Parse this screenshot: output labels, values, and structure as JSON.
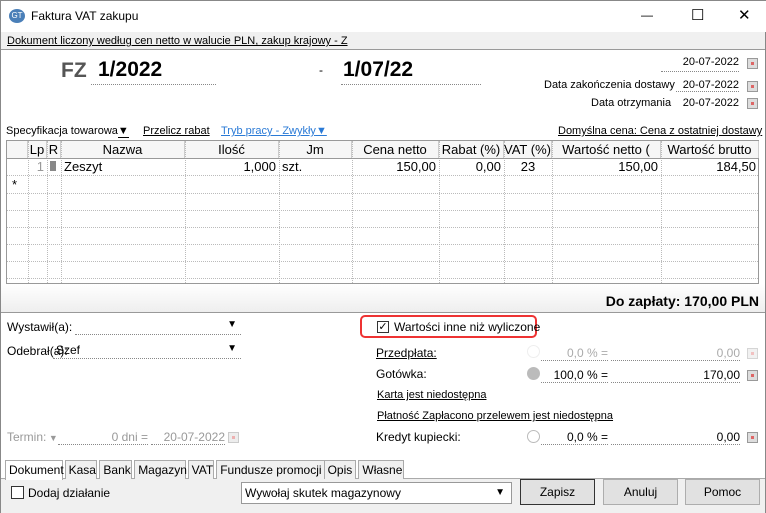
{
  "window": {
    "title": "Faktura VAT zakupu",
    "minimize": "—",
    "maximize": "☐",
    "close": "✕"
  },
  "doc_info": "Dokument liczony według cen netto w walucie PLN, zakup krajowy - Z",
  "header": {
    "prefix": "FZ",
    "number": "1/2022",
    "separator": "-",
    "suffix": "1/07/22",
    "date_issue": "20-07-2022",
    "date_delivery_label": "Data zakończenia dostawy",
    "date_delivery": "20-07-2022",
    "date_received_label": "Data otrzymania",
    "date_received": "20-07-2022"
  },
  "toolbar": {
    "spec": "Specyfikacja towarowa",
    "recalc": "Przelicz rabat",
    "mode": "Tryb pracy - Zwykły",
    "default_price": "Domyślna cena: Cena z ostatniej dostawy"
  },
  "table": {
    "columns": [
      "Lp",
      "R",
      "Nazwa",
      "Ilość",
      "Jm",
      "Cena netto",
      "Rabat (%)",
      "VAT (%)",
      "Wartość netto (",
      "Wartość brutto"
    ],
    "rows": [
      {
        "lp": "1",
        "name": "Zeszyt",
        "qty": "1,000",
        "unit": "szt.",
        "price": "150,00",
        "discount": "0,00",
        "vat": "23",
        "net": "150,00",
        "gross": "184,50"
      }
    ],
    "new_row_marker": "*"
  },
  "total": "Do zapłaty: 170,00 PLN",
  "left": {
    "issued_label": "Wystawił(a):",
    "issued_value": "",
    "received_label": "Odebrał(a):",
    "received_value": "Szef",
    "term_label": "Termin:",
    "term_days": "0 dni =",
    "term_date": "20-07-2022"
  },
  "payment": {
    "override_label": "Wartości inne niż wyliczone",
    "override_checked": true,
    "prepay_label": "Przedpłata:",
    "prepay_pct": "0,0 % =",
    "prepay_val": "0,00",
    "cash_label": "Gotówka:",
    "cash_pct": "100,0 % =",
    "cash_val": "170,00",
    "card": "Karta jest niedostępna",
    "transfer": "Płatność Zapłacono przelewem jest niedostępna",
    "credit_label": "Kredyt kupiecki:",
    "credit_pct": "0,0 % =",
    "credit_val": "0,00"
  },
  "tabs": [
    "Dokument",
    "Kasa",
    "Bank",
    "Magazyn",
    "VAT",
    "Fundusze promocji",
    "Opis",
    "Własne"
  ],
  "footer": {
    "add_action": "Dodaj działanie",
    "warehouse": "Wywołaj skutek magazynowy",
    "save": "Zapisz",
    "cancel": "Anuluj",
    "help": "Pomoc"
  }
}
